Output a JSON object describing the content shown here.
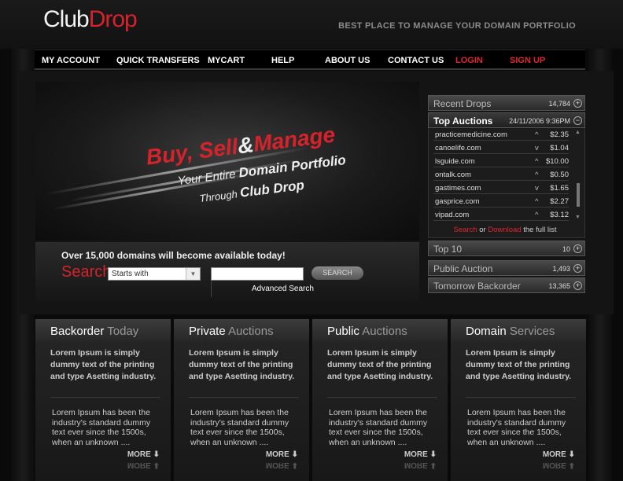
{
  "logo": {
    "part1": "Club",
    "part2": "Drop"
  },
  "tagline": "BEST PLACE TO MANAGE YOUR DOMAIN PORTFOLIO",
  "nav": [
    {
      "label": "MY ACCOUNT"
    },
    {
      "label": "QUICK TRANSFERS"
    },
    {
      "label": "MYCART"
    },
    {
      "label": "HELP"
    },
    {
      "label": "ABOUT US"
    },
    {
      "label": "CONTACT US"
    },
    {
      "label": "LOGIN"
    },
    {
      "label": "SIGN UP"
    }
  ],
  "banner": {
    "buy": "Buy,",
    "sell": "Sell",
    "amp": "&",
    "manage": "Manage",
    "line2_a": "Your Entire",
    "line2_b": "Domain Portfolio",
    "line3_a": "Through",
    "line3_b": "Club Drop"
  },
  "search": {
    "headline": "Over 15,000 domains will become available today!",
    "label": "Search",
    "select_value": "Starts with",
    "button": "SEARCH",
    "advanced": "Advanced Search"
  },
  "side": {
    "recent_drops": {
      "label": "Recent Drops",
      "count": "14,784"
    },
    "top_auctions": {
      "label": "Top Auctions",
      "date": "24/11/2006 9:36PM"
    },
    "auctions": [
      {
        "domain": "practicemedicine.com",
        "arrow": "^",
        "price": "$2.35"
      },
      {
        "domain": "canoelife.com",
        "arrow": "v",
        "price": "$1.04"
      },
      {
        "domain": "lsguide.com",
        "arrow": "^",
        "price": "$10.00"
      },
      {
        "domain": "ontalk.com",
        "arrow": "^",
        "price": "$0.50"
      },
      {
        "domain": "gastimes.com",
        "arrow": "v",
        "price": "$1.65"
      },
      {
        "domain": "gasprice.com",
        "arrow": "^",
        "price": "$2.27"
      },
      {
        "domain": "vipad.com",
        "arrow": "^",
        "price": "$3.12"
      }
    ],
    "full_list": {
      "search": "Search",
      "or": "or",
      "download": "Download",
      "rest": "the full list"
    },
    "top10": {
      "label": "Top 10",
      "count": "10"
    },
    "public_auction": {
      "label": "Public Auction",
      "count": "1,493"
    },
    "tomorrow_backorder": {
      "label": "Tomorrow Backorder",
      "count": "13,365"
    }
  },
  "columns": [
    {
      "title_a": "Backorder",
      "title_b": "Today",
      "bold": "Lorem Ipsum is simply dummy text of the printing and type Asetting industry.",
      "body": "Lorem Ipsum has been the industry's standard dummy text ever since the 1500s, when an unknown ....",
      "more": "MORE"
    },
    {
      "title_a": "Private",
      "title_b": "Auctions",
      "bold": "Lorem Ipsum is simply dummy text of the printing and type Asetting industry.",
      "body": "Lorem Ipsum has been the industry's standard dummy text ever since the 1500s, when an unknown ....",
      "more": "MORE"
    },
    {
      "title_a": "Public",
      "title_b": "Auctions",
      "bold": "Lorem Ipsum is simply dummy text of the printing and type Asetting industry.",
      "body": "Lorem Ipsum has been the industry's standard dummy text ever since the 1500s, when an unknown ....",
      "more": "MORE"
    },
    {
      "title_a": "Domain",
      "title_b": "Services",
      "bold": "Lorem Ipsum is simply dummy text of the printing and type Asetting industry.",
      "body": "Lorem Ipsum has been the industry's standard dummy text ever since the 1500s, when an unknown ....",
      "more": "MORE"
    }
  ],
  "colors": {
    "brand_red": "#d6232b",
    "background": "#0a0a0a"
  }
}
